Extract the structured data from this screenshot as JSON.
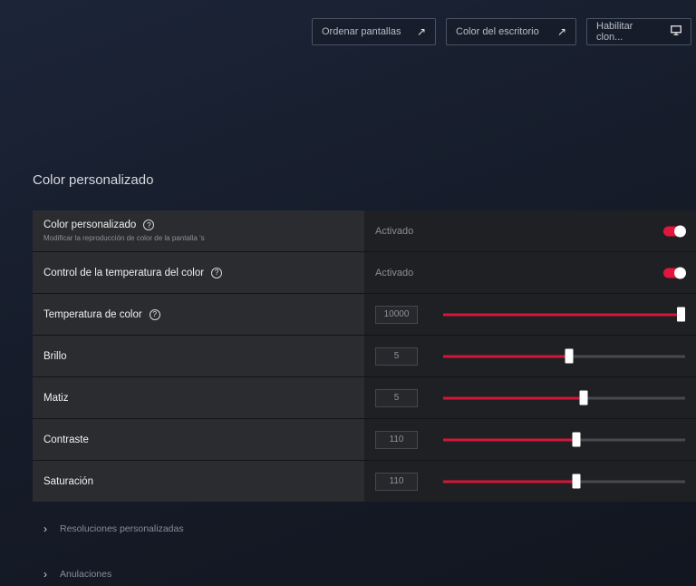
{
  "topbar": {
    "buttons": [
      {
        "label": "Ordenar pantallas",
        "icon": "external-link-icon"
      },
      {
        "label": "Color del escritorio",
        "icon": "external-link-icon"
      },
      {
        "label": "Habilitar clon...",
        "icon": "monitor-icon"
      }
    ]
  },
  "section": {
    "title": "Color personalizado"
  },
  "rows": [
    {
      "label": "Color personalizado",
      "sublabel": "Modificar la reproducción de color de la pantalla 's",
      "status": "Activado",
      "toggle_on": true
    },
    {
      "label": "Control de la temperatura del color",
      "status": "Activado",
      "toggle_on": true
    },
    {
      "label": "Temperatura de color",
      "value": "10000",
      "level_percent": 100
    },
    {
      "label": "Brillo",
      "value": "5",
      "level_percent": 52
    },
    {
      "label": "Matiz",
      "value": "5",
      "level_percent": 58
    },
    {
      "label": "Contraste",
      "value": "110",
      "level_percent": 55
    },
    {
      "label": "Saturación",
      "value": "110",
      "level_percent": 55
    }
  ],
  "expanders": [
    {
      "label": "Resoluciones personalizadas"
    },
    {
      "label": "Anulaciones"
    }
  ],
  "colors": {
    "accent": "#d3163a"
  }
}
